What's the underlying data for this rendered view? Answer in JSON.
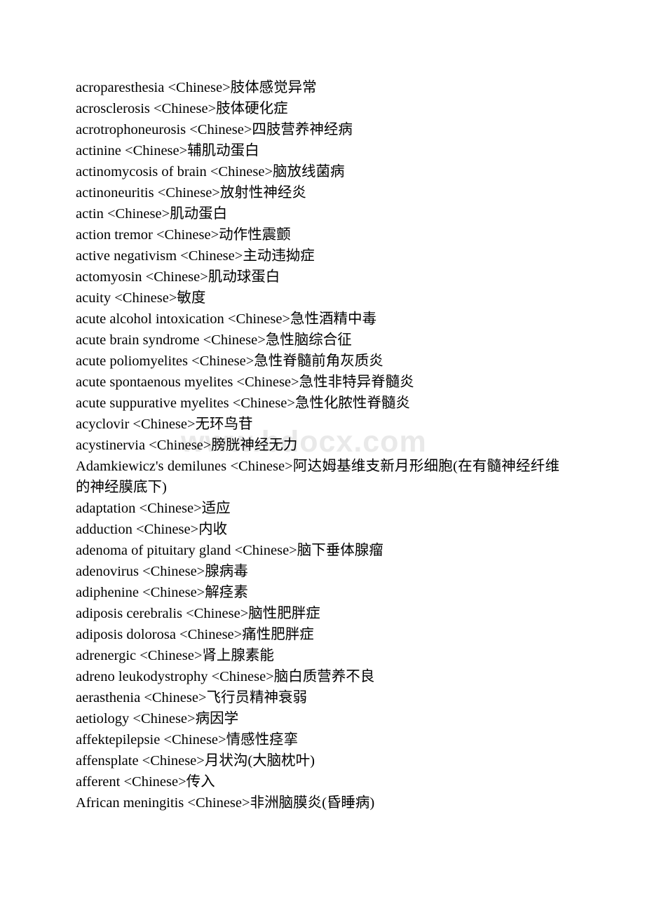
{
  "document": {
    "type": "glossary-list",
    "language_pair": "English to Chinese",
    "background_color": "#ffffff",
    "text_color": "#000000"
  },
  "watermark": {
    "text": "www.bdocx.com",
    "color": "#e9e9e9"
  },
  "entries": [
    "acroparesthesia <Chinese>肢体感觉异常",
    "acrosclerosis <Chinese>肢体硬化症",
    "acrotrophoneurosis <Chinese>四肢营养神经病",
    "actinine <Chinese>辅肌动蛋白",
    "actinomycosis of brain <Chinese>脑放线菌病",
    "actinoneuritis <Chinese>放射性神经炎",
    "actin <Chinese>肌动蛋白",
    "action tremor <Chinese>动作性震颤",
    "active negativism <Chinese>主动违拗症",
    "actomyosin <Chinese>肌动球蛋白",
    "acuity <Chinese>敏度",
    "acute alcohol intoxication <Chinese>急性酒精中毒",
    "acute brain syndrome <Chinese>急性脑综合征",
    "acute poliomyelites <Chinese>急性脊髓前角灰质炎",
    "acute spontaenous myelites <Chinese>急性非特异脊髓炎",
    "acute suppurative myelites <Chinese>急性化脓性脊髓炎",
    "acyclovir <Chinese>无环鸟苷",
    "acystinervia <Chinese>膀胱神经无力",
    "Adamkiewicz's demilunes <Chinese>阿达姆基维支新月形细胞(在有髓神经纤维的神经膜底下)",
    "adaptation <Chinese>适应",
    "adduction <Chinese>内收",
    "adenoma of pituitary gland <Chinese>脑下垂体腺瘤",
    "adenovirus <Chinese>腺病毒",
    "adiphenine <Chinese>解痉素",
    "adiposis cerebralis <Chinese>脑性肥胖症",
    "adiposis dolorosa <Chinese>痛性肥胖症",
    "adrenergic <Chinese>肾上腺素能",
    "adreno leukodystrophy <Chinese>脑白质营养不良",
    "aerasthenia <Chinese>飞行员精神衰弱",
    "aetiology <Chinese>病因学",
    "affektepilepsie <Chinese>情感性痉挛",
    "affensplate <Chinese>月状沟(大脑枕叶)",
    "afferent <Chinese>传入",
    "African meningitis <Chinese>非洲脑膜炎(昏睡病)"
  ]
}
